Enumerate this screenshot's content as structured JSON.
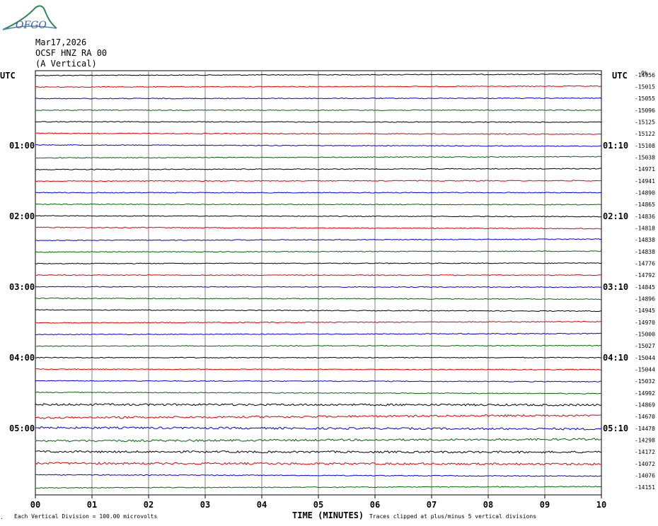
{
  "header": {
    "logo_text": "OFGO",
    "date": "Mar17,2026",
    "station": "OCSF HNZ RA 00",
    "component": "(A Vertical)"
  },
  "colors": {
    "black": "#000000",
    "red": "#e00000",
    "blue": "#0000dd",
    "green": "#006600",
    "grid": "#808080"
  },
  "chart_data": {
    "type": "line",
    "title": "",
    "xlabel": "TIME (MINUTES)",
    "x_ticks": [
      "00",
      "01",
      "02",
      "03",
      "04",
      "05",
      "06",
      "07",
      "08",
      "09",
      "10"
    ],
    "xlim": [
      0,
      10
    ],
    "left_axis_title": "UTC",
    "right_axis_title": "UTC",
    "left_hour_labels": [
      {
        "row": 6,
        "label": "01:00"
      },
      {
        "row": 12,
        "label": "02:00"
      },
      {
        "row": 18,
        "label": "03:00"
      },
      {
        "row": 24,
        "label": "04:00"
      },
      {
        "row": 30,
        "label": "05:00"
      }
    ],
    "right_hour_labels": [
      {
        "row": 6,
        "label": "01:10"
      },
      {
        "row": 12,
        "label": "02:10"
      },
      {
        "row": 18,
        "label": "03:10"
      },
      {
        "row": 24,
        "label": "04:10"
      },
      {
        "row": 30,
        "label": "05:10"
      }
    ],
    "trace_colors": [
      "black",
      "red",
      "blue",
      "green"
    ],
    "trace_offsets": [
      -14956,
      -15015,
      -15055,
      -15096,
      -15125,
      -15122,
      -15108,
      -15038,
      -14971,
      -14941,
      -14890,
      -14865,
      -14836,
      -14818,
      -14838,
      -14838,
      -14776,
      -14792,
      -14845,
      -14896,
      -14945,
      -14970,
      -15000,
      -15027,
      -15044,
      -15044,
      -15032,
      -14992,
      -14869,
      -14670,
      -14478,
      -14298,
      -14172,
      -14072,
      -14076,
      -14151
    ],
    "footer_left": "Each Vertical Division =  100.00 microvolts",
    "footer_right": "Traces clipped at plus/minus 5 vertical divisions",
    "corner_mark": "0%"
  }
}
